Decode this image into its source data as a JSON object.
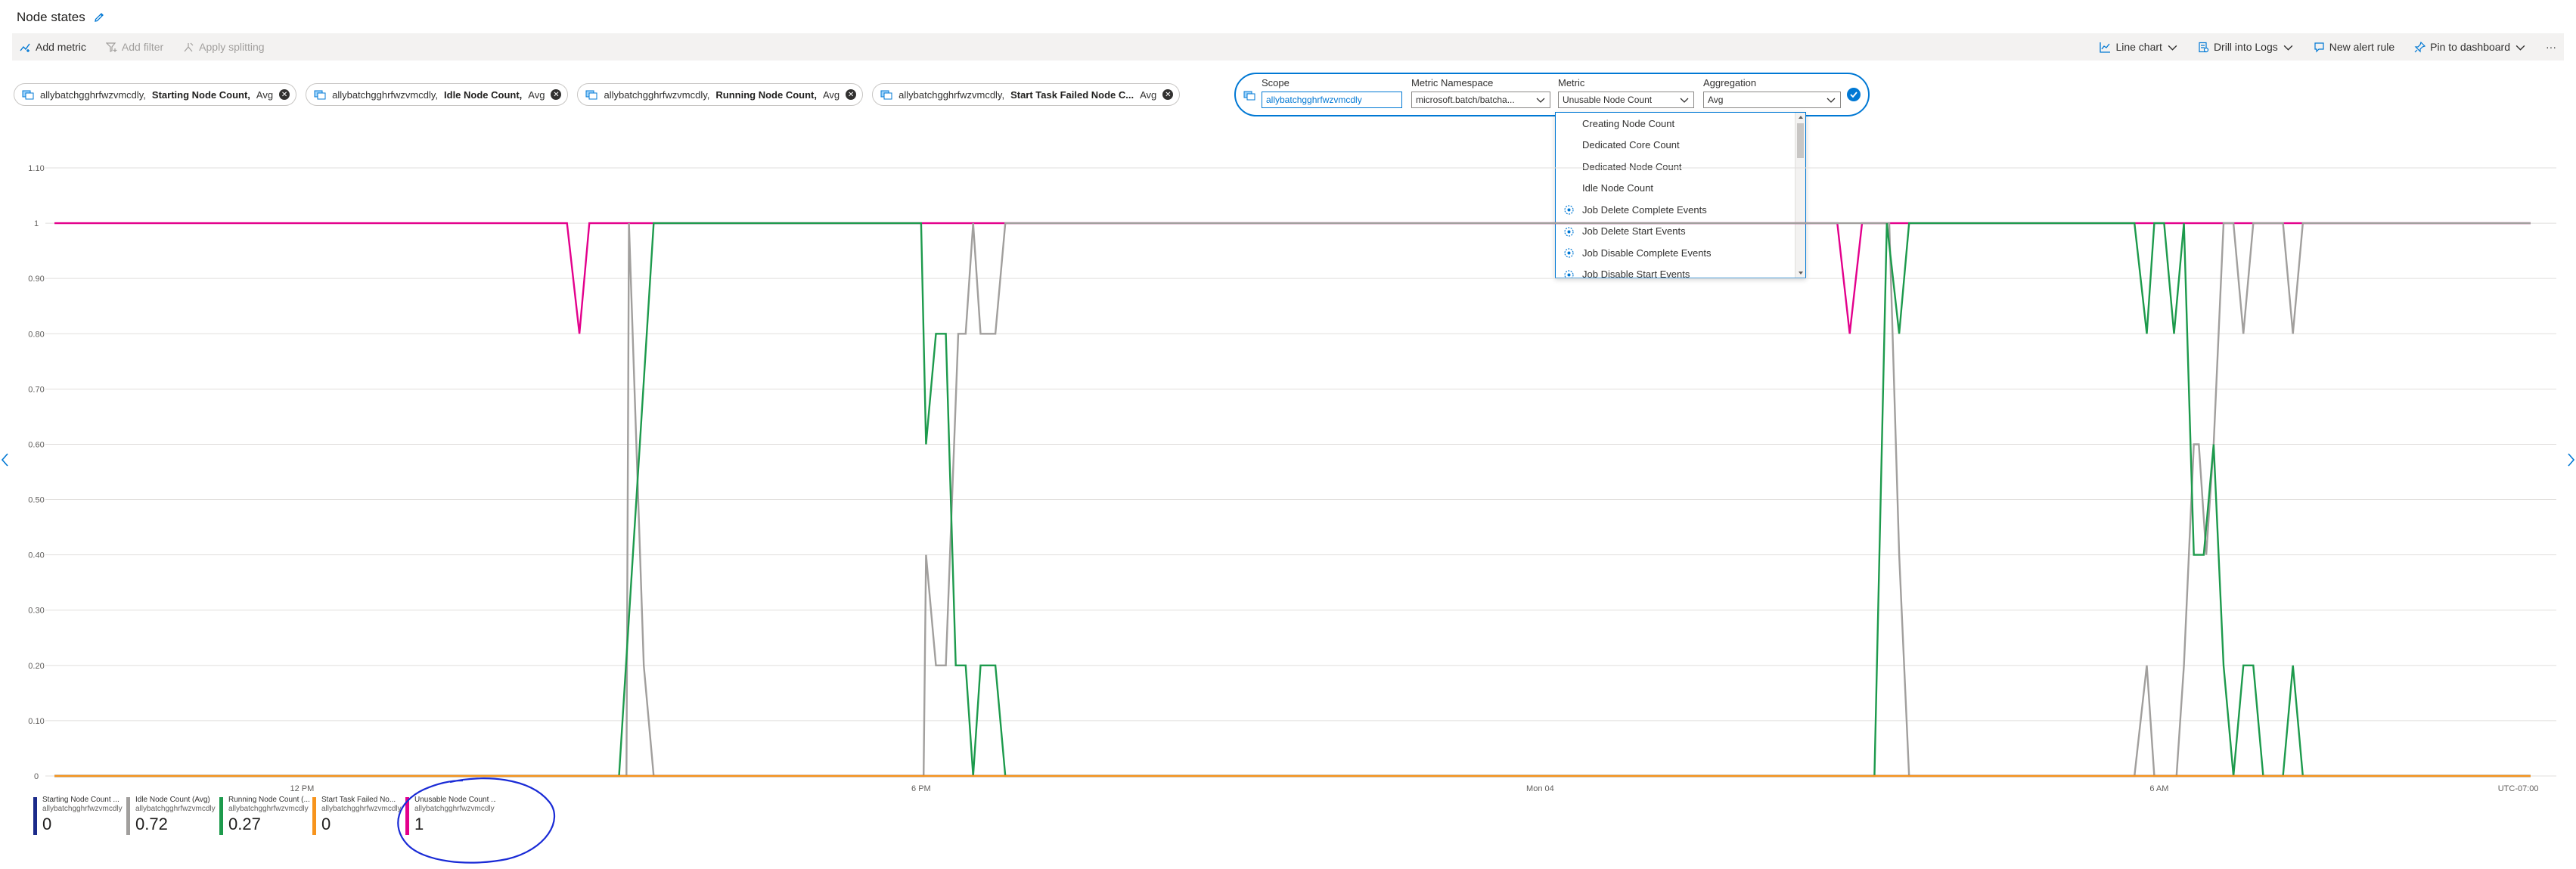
{
  "page": {
    "title": "Node states"
  },
  "toolbar": {
    "add_metric": "Add metric",
    "add_filter": "Add filter",
    "apply_splitting": "Apply splitting",
    "line_chart": "Line chart",
    "drill_into_logs": "Drill into Logs",
    "new_alert_rule": "New alert rule",
    "pin_to_dashboard": "Pin to dashboard",
    "more": "···"
  },
  "pills": [
    {
      "resource": "allybatchgghrfwzvmcdly,",
      "metric": "Starting Node Count,",
      "agg": "Avg"
    },
    {
      "resource": "allybatchgghrfwzvmcdly,",
      "metric": "Idle Node Count,",
      "agg": "Avg"
    },
    {
      "resource": "allybatchgghrfwzvmcdly,",
      "metric": "Running Node Count,",
      "agg": "Avg"
    },
    {
      "resource": "allybatchgghrfwzvmcdly,",
      "metric": "Start Task Failed Node C...",
      "agg": "Avg"
    }
  ],
  "editor": {
    "scope_label": "Scope",
    "scope_value": "allybatchgghrfwzvmcdly",
    "namespace_label": "Metric Namespace",
    "namespace_value": "microsoft.batch/batcha...",
    "metric_label": "Metric",
    "metric_value": "Unusable Node Count",
    "aggregation_label": "Aggregation",
    "aggregation_value": "Avg"
  },
  "dropdown": {
    "items": [
      {
        "label": "Creating Node Count",
        "icon": ""
      },
      {
        "label": "Dedicated Core Count",
        "icon": ""
      },
      {
        "label": "Dedicated Node Count",
        "icon": ""
      },
      {
        "label": "Idle Node Count",
        "icon": ""
      },
      {
        "label": "Job Delete Complete Events",
        "icon": "event-icon"
      },
      {
        "label": "Job Delete Start Events",
        "icon": "event-icon"
      },
      {
        "label": "Job Disable Complete Events",
        "icon": "event-icon"
      },
      {
        "label": "Job Disable Start Events",
        "icon": "event-icon"
      }
    ]
  },
  "chart_data": {
    "type": "line",
    "y_ticks": [
      "0",
      "0.10",
      "0.20",
      "0.30",
      "0.40",
      "0.50",
      "0.60",
      "0.70",
      "0.80",
      "0.90",
      "1",
      "1.10"
    ],
    "ylim": [
      0,
      1.1
    ],
    "x_tick_labels": [
      "12 PM",
      "6 PM",
      "Mon 04",
      "6 AM",
      "UTC-07:00"
    ],
    "x_tick_positions": [
      0.1,
      0.35,
      0.6,
      0.85,
      0.995
    ],
    "grid": true,
    "legend_position": "bottom-left",
    "series": [
      {
        "name": "Unusable Node Count",
        "color": "#e3008c",
        "points": [
          [
            0,
            1
          ],
          [
            0.207,
            1
          ],
          [
            0.212,
            0.8
          ],
          [
            0.216,
            1
          ],
          [
            0.72,
            1
          ],
          [
            0.725,
            0.8
          ],
          [
            0.73,
            1
          ],
          [
            1,
            1
          ]
        ]
      },
      {
        "name": "Idle Node Count (Avg)",
        "color": "#a19f9d",
        "points": [
          [
            0,
            0
          ],
          [
            0.231,
            0
          ],
          [
            0.232,
            1
          ],
          [
            0.238,
            0.2
          ],
          [
            0.242,
            0
          ],
          [
            0.35,
            0
          ],
          [
            0.351,
            0
          ],
          [
            0.352,
            0.4
          ],
          [
            0.356,
            0.2
          ],
          [
            0.36,
            0.2
          ],
          [
            0.365,
            0.8
          ],
          [
            0.368,
            0.8
          ],
          [
            0.371,
            1
          ],
          [
            0.374,
            0.8
          ],
          [
            0.38,
            0.8
          ],
          [
            0.384,
            1
          ],
          [
            0.74,
            1
          ],
          [
            0.741,
            1
          ],
          [
            0.745,
            0.4
          ],
          [
            0.749,
            0
          ],
          [
            0.84,
            0
          ],
          [
            0.845,
            0.2
          ],
          [
            0.848,
            0
          ],
          [
            0.852,
            0
          ],
          [
            0.857,
            0
          ],
          [
            0.86,
            0.2
          ],
          [
            0.864,
            0.6
          ],
          [
            0.866,
            0.6
          ],
          [
            0.869,
            0.4
          ],
          [
            0.872,
            0.6
          ],
          [
            0.876,
            1
          ],
          [
            0.88,
            1
          ],
          [
            0.884,
            0.8
          ],
          [
            0.888,
            1
          ],
          [
            0.9,
            1
          ],
          [
            0.904,
            0.8
          ],
          [
            0.908,
            1
          ],
          [
            1,
            1
          ]
        ]
      },
      {
        "name": "Running Node Count (Avg)",
        "color": "#1d9a4c",
        "points": [
          [
            0,
            0
          ],
          [
            0.228,
            0
          ],
          [
            0.242,
            1
          ],
          [
            0.35,
            1
          ],
          [
            0.352,
            0.6
          ],
          [
            0.356,
            0.8
          ],
          [
            0.36,
            0.8
          ],
          [
            0.364,
            0.2
          ],
          [
            0.368,
            0.2
          ],
          [
            0.371,
            0
          ],
          [
            0.374,
            0.2
          ],
          [
            0.38,
            0.2
          ],
          [
            0.384,
            0
          ],
          [
            0.735,
            0
          ],
          [
            0.74,
            1
          ],
          [
            0.745,
            0.8
          ],
          [
            0.749,
            1
          ],
          [
            0.84,
            1
          ],
          [
            0.845,
            0.8
          ],
          [
            0.848,
            1
          ],
          [
            0.852,
            1
          ],
          [
            0.856,
            0.8
          ],
          [
            0.86,
            1
          ],
          [
            0.864,
            0.4
          ],
          [
            0.868,
            0.4
          ],
          [
            0.872,
            0.6
          ],
          [
            0.876,
            0.2
          ],
          [
            0.88,
            0
          ],
          [
            0.884,
            0.2
          ],
          [
            0.888,
            0.2
          ],
          [
            0.892,
            0
          ],
          [
            0.9,
            0
          ],
          [
            0.904,
            0.2
          ],
          [
            0.908,
            0
          ],
          [
            1,
            0
          ]
        ]
      },
      {
        "name": "Starting Node Count (Avg)",
        "color": "#1b2a8a",
        "points": [
          [
            0,
            0
          ],
          [
            1,
            0
          ]
        ]
      },
      {
        "name": "Start Task Failed Node Count (Avg)",
        "color": "#f7941d",
        "points": [
          [
            0,
            0
          ],
          [
            1,
            0
          ]
        ]
      }
    ]
  },
  "legend": [
    {
      "name": "Starting Node Count ...",
      "resource": "allybatchgghrfwzvmcdly",
      "value": "0",
      "color": "#1b2a8a"
    },
    {
      "name": "Idle Node Count (Avg)",
      "resource": "allybatchgghrfwzvmcdly",
      "value": "0.72",
      "color": "#a19f9d"
    },
    {
      "name": "Running Node Count (...",
      "resource": "allybatchgghrfwzvmcdly",
      "value": "0.27",
      "color": "#1d9a4c"
    },
    {
      "name": "Start Task Failed No...",
      "resource": "allybatchgghrfwzvmcdly",
      "value": "0",
      "color": "#f7941d"
    },
    {
      "name": "Unusable Node Count ...",
      "resource": "allybatchgghrfwzvmcdly",
      "value": "1",
      "color": "#e3008c"
    }
  ]
}
